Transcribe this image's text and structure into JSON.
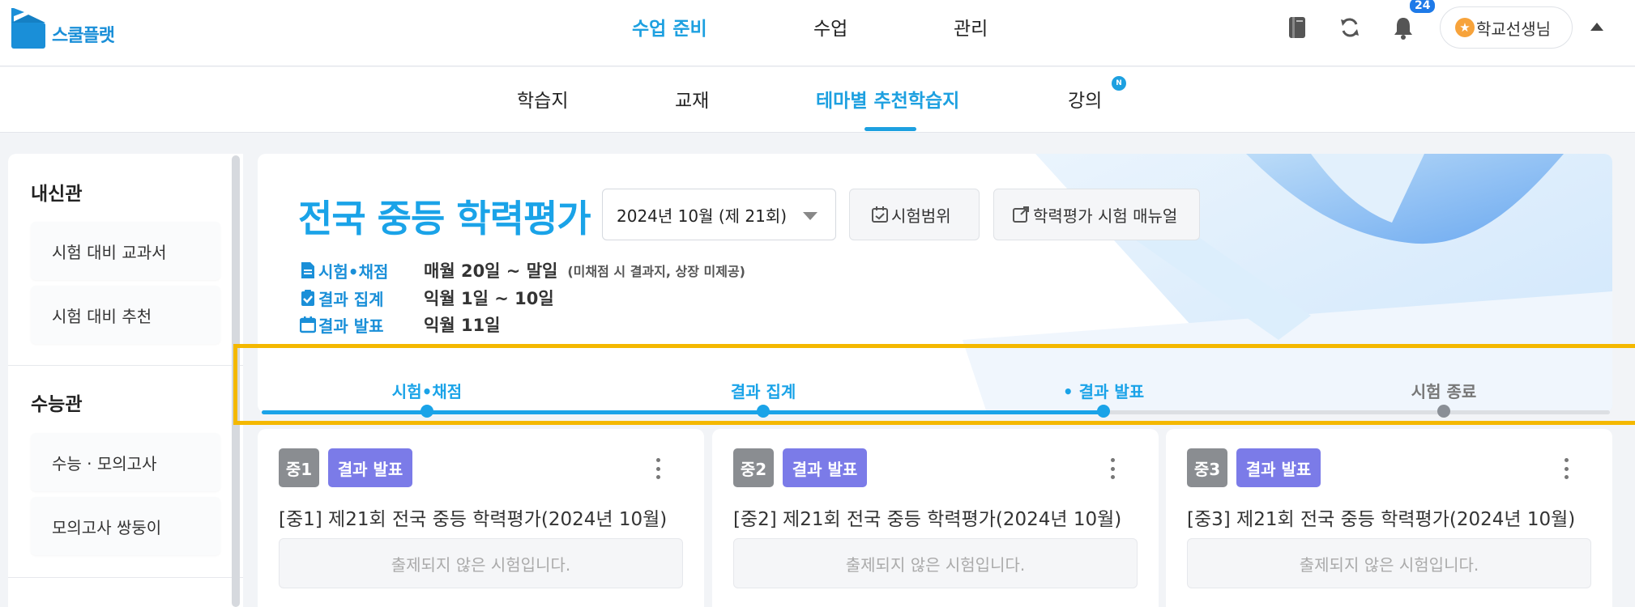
{
  "app": {
    "logo_text": "스쿨플랫"
  },
  "header": {
    "nav": [
      "수업 준비",
      "수업",
      "관리"
    ],
    "notification_count": "24",
    "user_name": "학교선생님"
  },
  "subnav": {
    "items": [
      "학습지",
      "교재",
      "테마별 추천학습지",
      "강의"
    ],
    "new_badge": "N"
  },
  "sidebar": {
    "sections": [
      {
        "title": "내신관",
        "items": [
          "시험 대비 교과서",
          "시험 대비 추천"
        ]
      },
      {
        "title": "수능관",
        "items": [
          "수능 · 모의고사",
          "모의고사 쌍둥이"
        ]
      }
    ]
  },
  "exam": {
    "title": "전국 중등 학력평가",
    "selected_round": "2024년 10월 (제 21회)",
    "range_button": "시험범위",
    "manual_button": "학력평가 시험 매뉴얼",
    "schedule": [
      {
        "label": "시험•채점",
        "value": "매월 20일 ~ 말일",
        "note": "(미채점 시 결과지, 상장 미제공)"
      },
      {
        "label": "결과 집계",
        "value": "익월 1일 ~ 10일",
        "note": ""
      },
      {
        "label": "결과 발표",
        "value": "익월 11일",
        "note": ""
      }
    ]
  },
  "progress": {
    "steps": [
      "시험•채점",
      "결과 집계",
      "• 결과 발표",
      "시험 종료"
    ],
    "current_step": 3
  },
  "cards": [
    {
      "grade": "중1",
      "status": "결과 발표",
      "title": "[중1] 제21회 전국 중등 학력평가(2024년 10월)",
      "empty_text": "출제되지 않은 시험입니다."
    },
    {
      "grade": "중2",
      "status": "결과 발표",
      "title": "[중2] 제21회 전국 중등 학력평가(2024년 10월)",
      "empty_text": "출제되지 않은 시험입니다."
    },
    {
      "grade": "중3",
      "status": "결과 발표",
      "title": "[중3] 제21회 전국 중등 학력평가(2024년 10월)",
      "empty_text": "출제되지 않은 시험입니다."
    }
  ],
  "colors": {
    "accent": "#1aa3e8",
    "status_badge": "#7b7be8",
    "highlight": "#f4b800"
  }
}
